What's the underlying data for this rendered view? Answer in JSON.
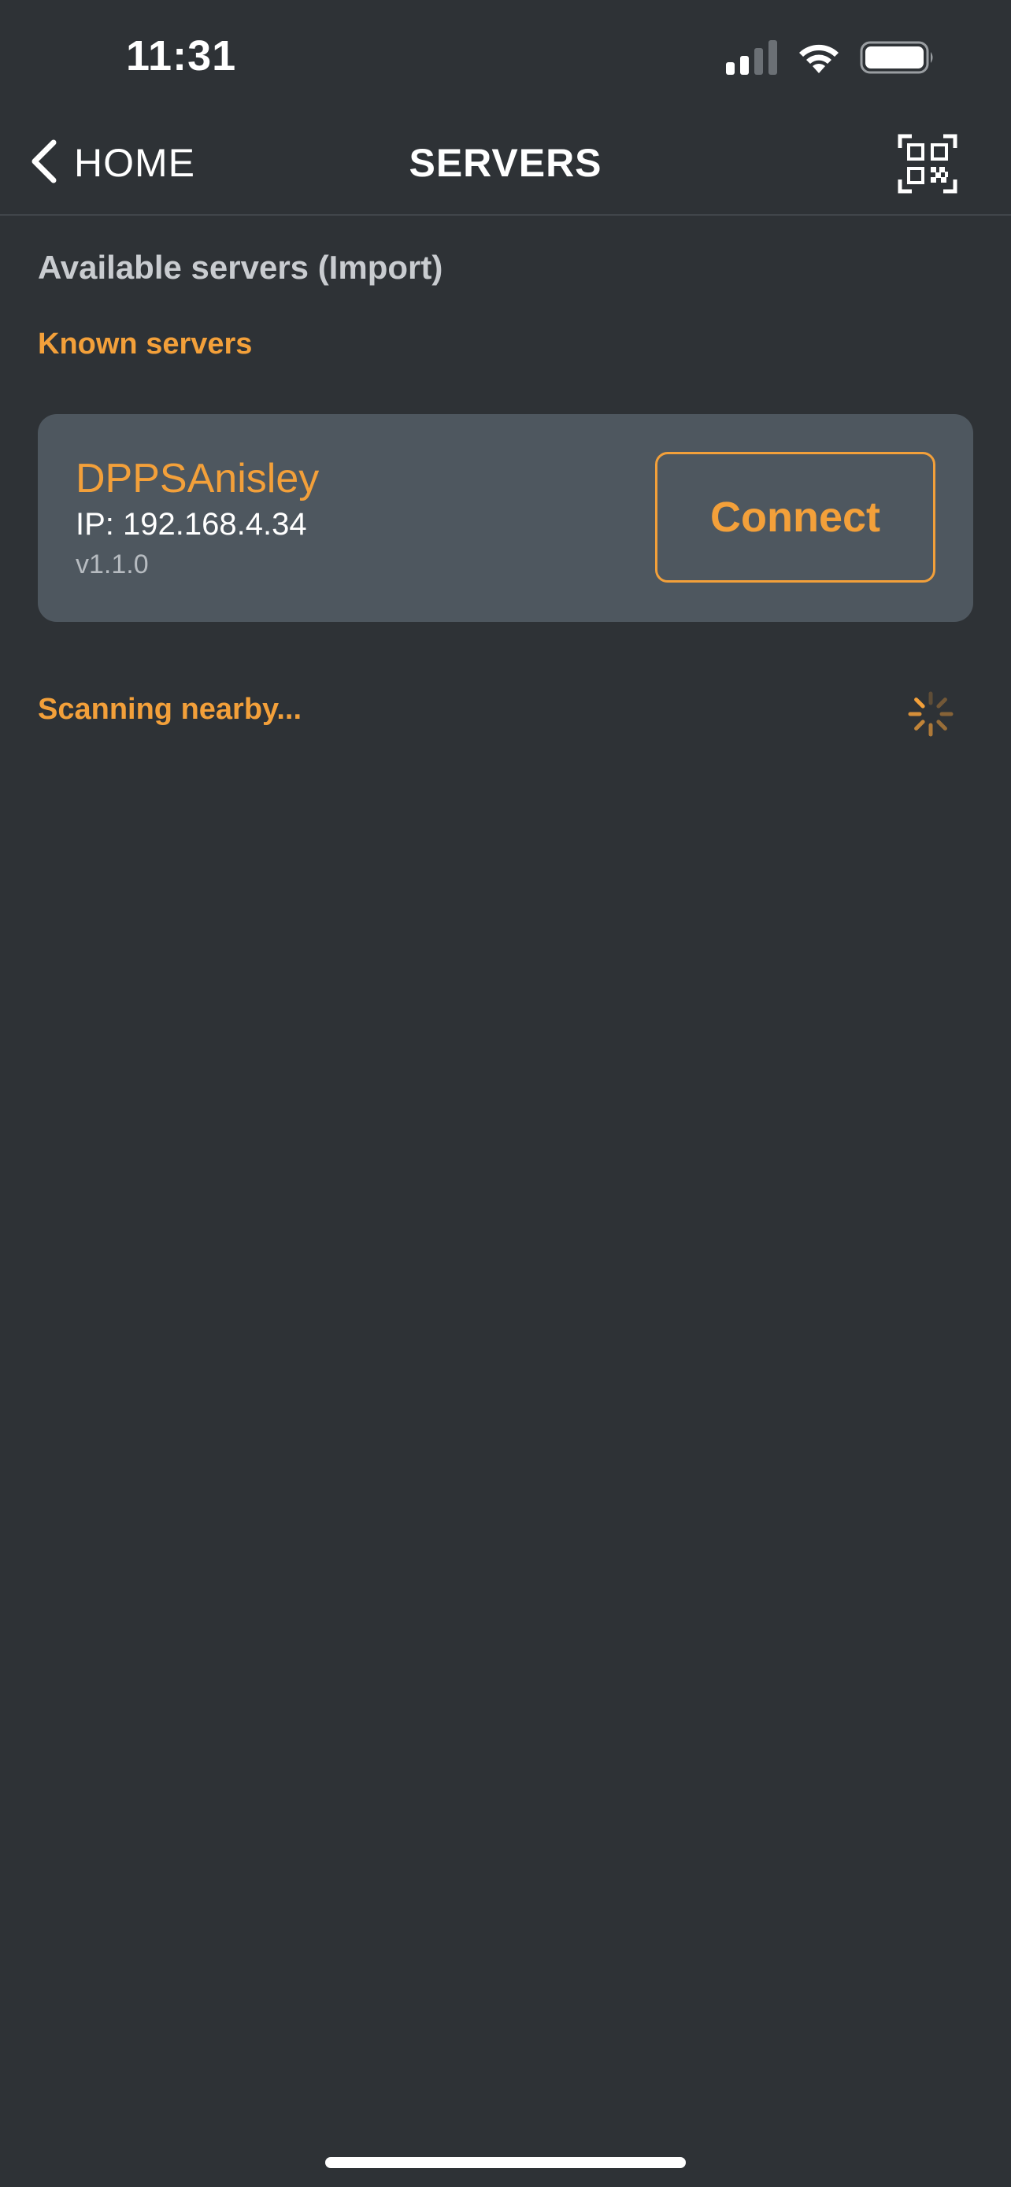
{
  "status_bar": {
    "time": "11:31",
    "icons": [
      "cellular-signal-icon",
      "wifi-icon",
      "battery-icon"
    ]
  },
  "nav": {
    "back_label": "HOME",
    "title": "SERVERS",
    "qr_icon": "qr-code-scan-icon"
  },
  "main": {
    "section_title": "Available servers (Import)",
    "known_servers_label": "Known servers",
    "servers": [
      {
        "name": "DPPSAnisley",
        "ip": "IP: 192.168.4.34",
        "version": "v1.1.0",
        "connect_label": "Connect"
      }
    ],
    "scanning_label": "Scanning nearby..."
  },
  "colors": {
    "background": "#2e3236",
    "card": "#4e575f",
    "accent": "#f3a03a",
    "text": "#ffffff",
    "muted_text": "#c9ccd0"
  }
}
